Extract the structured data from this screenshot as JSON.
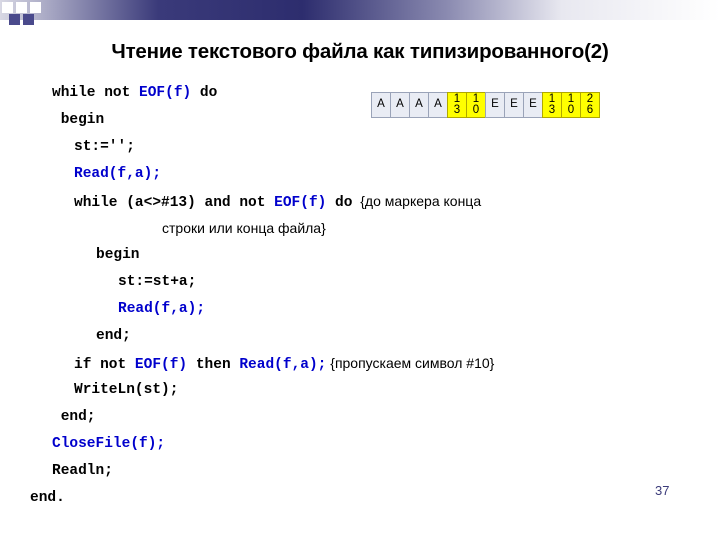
{
  "slide": {
    "title": "Чтение текстового файла как типизированного(2)",
    "page_number": "37"
  },
  "code": {
    "lines": [
      {
        "indent": 1,
        "segments": [
          {
            "text": "while not ",
            "style": "plain"
          },
          {
            "text": "EOF(f)",
            "style": "blue"
          },
          {
            "text": " do",
            "style": "plain"
          }
        ]
      },
      {
        "indent": 1,
        "segments": [
          {
            "text": " begin",
            "style": "plain"
          }
        ]
      },
      {
        "indent": 2,
        "segments": [
          {
            "text": "st:='';",
            "style": "plain"
          }
        ]
      },
      {
        "indent": 2,
        "segments": [
          {
            "text": "Read(f,a);",
            "style": "blue"
          }
        ]
      },
      {
        "indent": 2,
        "segments": [
          {
            "text": "while (a<>#13) and not ",
            "style": "plain"
          },
          {
            "text": "EOF(f)",
            "style": "blue"
          },
          {
            "text": " do",
            "style": "plain"
          },
          {
            "text": "  {до маркера конца",
            "style": "comment"
          }
        ]
      },
      {
        "indent": 6,
        "segments": [
          {
            "text": "строки или конца файла}",
            "style": "comment"
          }
        ]
      },
      {
        "indent": 3,
        "segments": [
          {
            "text": "begin",
            "style": "plain"
          }
        ]
      },
      {
        "indent": 4,
        "segments": [
          {
            "text": "st:=st+a;",
            "style": "plain"
          }
        ]
      },
      {
        "indent": 4,
        "segments": [
          {
            "text": "Read(f,a);",
            "style": "blue"
          }
        ]
      },
      {
        "indent": 3,
        "segments": [
          {
            "text": "end;",
            "style": "plain"
          }
        ]
      },
      {
        "indent": 2,
        "segments": [
          {
            "text": "if not ",
            "style": "plain"
          },
          {
            "text": "EOF(f)",
            "style": "blue"
          },
          {
            "text": " then ",
            "style": "plain"
          },
          {
            "text": "Read(f,a);",
            "style": "blue"
          },
          {
            "text": " {пропускаем символ #10}",
            "style": "comment"
          }
        ]
      },
      {
        "indent": 2,
        "segments": [
          {
            "text": "WriteLn(st);",
            "style": "plain"
          }
        ]
      },
      {
        "indent": 1,
        "segments": [
          {
            "text": " end;",
            "style": "plain"
          }
        ]
      },
      {
        "indent": 1,
        "segments": [
          {
            "text": "CloseFile(f);",
            "style": "blue"
          }
        ]
      },
      {
        "indent": 1,
        "segments": [
          {
            "text": "Readln;",
            "style": "plain"
          }
        ]
      },
      {
        "indent": 0,
        "segments": [
          {
            "text": "end.",
            "style": "plain"
          }
        ]
      }
    ]
  },
  "buffer": {
    "cells": [
      {
        "text": "A",
        "highlight": false
      },
      {
        "text": "A",
        "highlight": false
      },
      {
        "text": "A",
        "highlight": false
      },
      {
        "text": "A",
        "highlight": false
      },
      {
        "top": "1",
        "bottom": "3",
        "highlight": true
      },
      {
        "top": "1",
        "bottom": "0",
        "highlight": true
      },
      {
        "text": "E",
        "highlight": false
      },
      {
        "text": "E",
        "highlight": false
      },
      {
        "text": "E",
        "highlight": false
      },
      {
        "top": "1",
        "bottom": "3",
        "highlight": true
      },
      {
        "top": "1",
        "bottom": "0",
        "highlight": true
      },
      {
        "top": "2",
        "bottom": "6",
        "highlight": true
      }
    ]
  },
  "colors": {
    "keyword": "#0000cc",
    "highlight": "#ffff00",
    "cell_fill": "#e9ecf4",
    "page_number": "#3b3b7a"
  }
}
